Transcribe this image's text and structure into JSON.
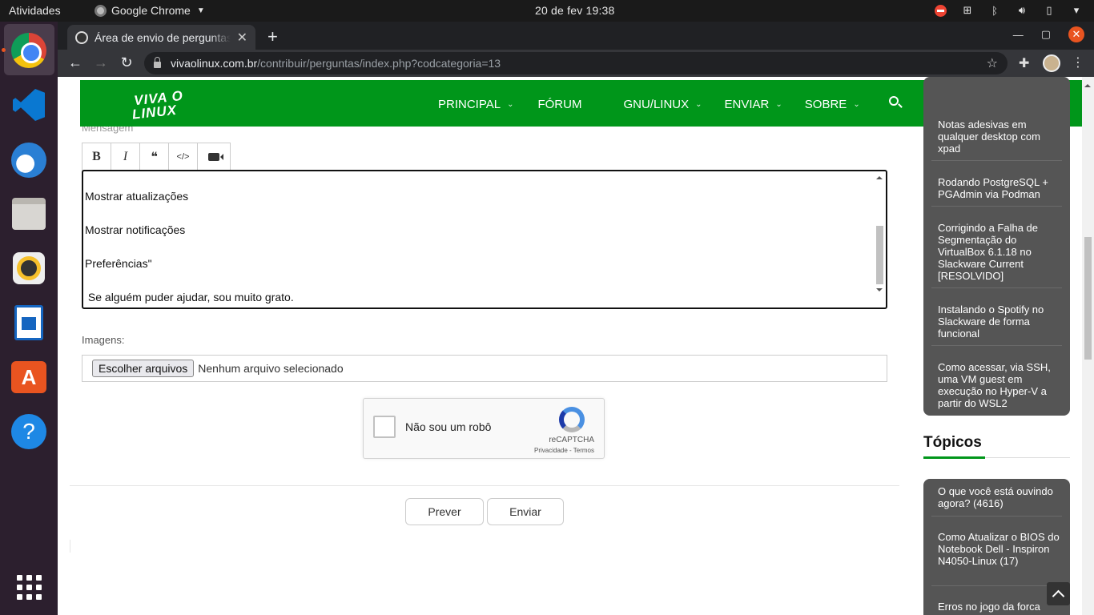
{
  "system": {
    "activities": "Atividades",
    "app_name": "Google Chrome",
    "clock": "20 de fev  19:38"
  },
  "dock": {
    "apps": [
      "Google Chrome",
      "Visual Studio Code",
      "Thunderbird",
      "Arquivos",
      "Rhythmbox",
      "LibreOffice Writer",
      "Ubuntu Software",
      "Ajuda",
      "Mostrar aplicativos"
    ]
  },
  "browser": {
    "tab_title": "Área de envio de perguntas",
    "url_host": "vivaolinux.com.br",
    "url_path": "/contribuir/perguntas/index.php?codcategoria=13"
  },
  "site": {
    "logo_line1": "VIVA O",
    "logo_line2": "LINUX",
    "nav": [
      {
        "label": "PRINCIPAL"
      },
      {
        "label": "FÓRUM"
      },
      {
        "label": "GNU/LINUX"
      },
      {
        "label": "ENVIAR"
      },
      {
        "label": "SOBRE"
      }
    ]
  },
  "form": {
    "message_label": "Mensagem",
    "toolbar": {
      "bold": "B",
      "italic": "I",
      "quote": "❝",
      "code": "</>"
    },
    "message_lines": [
      "Mostrar atualizações",
      "Mostrar notificações",
      "Preferências\"",
      " Se alguém puder ajudar, sou muito grato."
    ],
    "images_label": "Imagens:",
    "file_button": "Escolher arquivos",
    "file_status": "Nenhum arquivo selecionado",
    "captcha_text": "Não sou um robô",
    "captcha_brand": "reCAPTCHA",
    "captcha_terms": "Privacidade - Termos",
    "preview_button": "Prever",
    "submit_button": "Enviar"
  },
  "sidebar": {
    "articles": [
      "Notas adesivas em qualquer desktop com xpad",
      "Rodando PostgreSQL + PGAdmin via Podman",
      "Corrigindo a Falha de Segmentação do VirtualBox 6.1.18 no Slackware Current [RESOLVIDO]",
      "Instalando o Spotify no Slackware de forma funcional",
      "Como acessar, via SSH, uma VM guest em execução no Hyper-V a partir do WSL2"
    ],
    "topics_title": "Tópicos",
    "topics": [
      "O que você está ouvindo agora? (4616)",
      "Como Atualizar o BIOS do Notebook Dell - Inspiron N4050-Linux (17)",
      "Erros no jogo da forca"
    ]
  },
  "colors": {
    "site_green": "#00961a",
    "sidebar_gray": "#555555",
    "ubuntu_orange": "#e95420"
  }
}
